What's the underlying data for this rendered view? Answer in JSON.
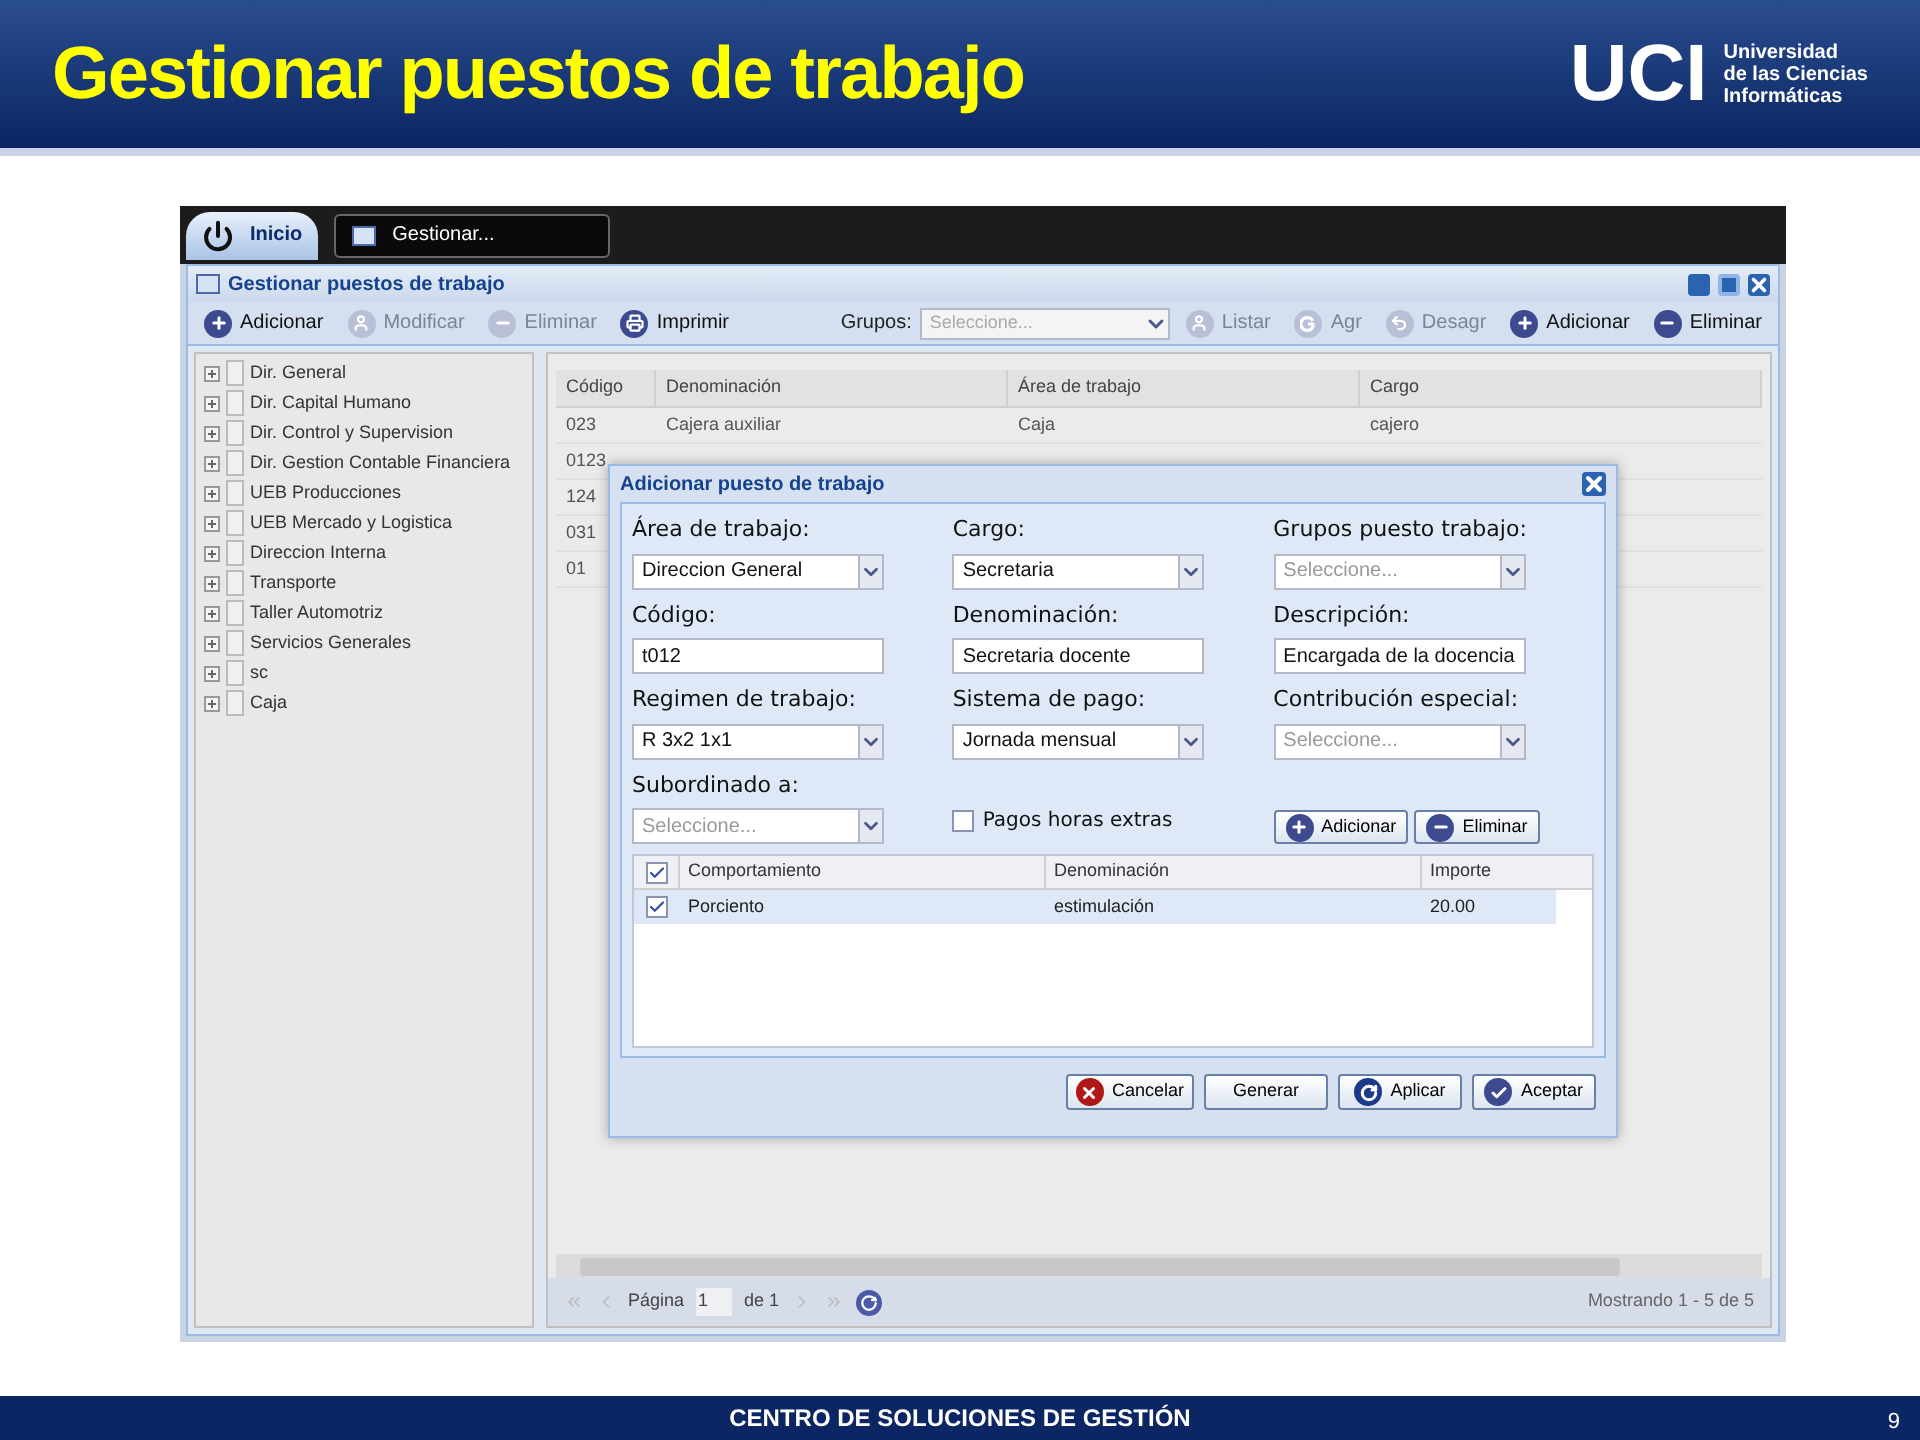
{
  "slide": {
    "title": "Gestionar puestos de trabajo",
    "logo": {
      "abbr": "UCI",
      "lines": [
        "Universidad",
        "de las Ciencias",
        "Informáticas"
      ]
    },
    "footer": "CENTRO DE SOLUCIONES DE GESTIÓN",
    "page": "9"
  },
  "taskbar": {
    "start": "Inicio",
    "tabs": [
      {
        "label": "Gestionar...",
        "selected": true
      }
    ]
  },
  "window": {
    "title": "Gestionar puestos de trabajo",
    "toolbar_left": [
      {
        "label": "Adicionar",
        "kind": "add",
        "disabled": false
      },
      {
        "label": "Modificar",
        "kind": "edit",
        "disabled": true
      },
      {
        "label": "Eliminar",
        "kind": "remove",
        "disabled": true
      },
      {
        "label": "Imprimir",
        "kind": "print",
        "disabled": false
      }
    ],
    "groups": {
      "label": "Grupos:",
      "placeholder": "Seleccione..."
    },
    "toolbar_right": [
      {
        "label": "Listar",
        "kind": "edit",
        "disabled": true
      },
      {
        "label": "Agr",
        "kind": "letter",
        "disabled": true
      },
      {
        "label": "Desagr",
        "kind": "back",
        "disabled": true
      },
      {
        "label": "Adicionar",
        "kind": "add",
        "disabled": false
      },
      {
        "label": "Eliminar",
        "kind": "remove",
        "disabled": false
      }
    ]
  },
  "tree": [
    {
      "label": "Dir. General"
    },
    {
      "label": "Dir. Capital Humano"
    },
    {
      "label": "Dir. Control y Supervision"
    },
    {
      "label": "Dir. Gestion Contable Financiera"
    },
    {
      "label": "UEB Producciones"
    },
    {
      "label": "UEB Mercado y Logistica"
    },
    {
      "label": "Direccion Interna"
    },
    {
      "label": "Transporte"
    },
    {
      "label": "Taller Automotriz"
    },
    {
      "label": "Servicios Generales"
    },
    {
      "label": "sc"
    },
    {
      "label": "Caja"
    }
  ],
  "grid": {
    "columns": [
      "Código",
      "Denominación",
      "Área de trabajo",
      "Cargo"
    ],
    "rows": [
      [
        "023",
        "Cajera auxiliar",
        "Caja",
        "cajero"
      ],
      [
        "0123"
      ],
      [
        "124"
      ],
      [
        "031"
      ],
      [
        "01"
      ]
    ]
  },
  "pager": {
    "page_label": "Página",
    "page": "1",
    "of": "de 1",
    "status": "Mostrando 1 - 5 de 5"
  },
  "dialog": {
    "title": "Adicionar puesto de trabajo",
    "fields": [
      {
        "label": "Área de trabajo:",
        "kind": "select",
        "value": "Direccion General"
      },
      {
        "label": "Cargo:",
        "kind": "select",
        "value": "Secretaria"
      },
      {
        "label": "Grupos puesto trabajo:",
        "kind": "select",
        "placeholder": "Seleccione..."
      },
      {
        "label": "Código:",
        "kind": "text",
        "value": "t012"
      },
      {
        "label": "Denominación:",
        "kind": "text",
        "value": "Secretaria docente"
      },
      {
        "label": "Descripción:",
        "kind": "text",
        "value": "Encargada de la docencia"
      },
      {
        "label": "Regimen de trabajo:",
        "kind": "select",
        "value": "R 3x2 1x1"
      },
      {
        "label": "Sistema de pago:",
        "kind": "select",
        "value": "Jornada mensual"
      },
      {
        "label": "Contribución especial:",
        "kind": "select",
        "placeholder": "Seleccione..."
      },
      {
        "label": "Subordinado a:",
        "kind": "select",
        "placeholder": "Seleccione..."
      }
    ],
    "checkbox": {
      "label": "Pagos horas extras",
      "checked": false
    },
    "buttons": [
      {
        "label": "Adicionar",
        "kind": "add"
      },
      {
        "label": "Eliminar",
        "kind": "remove"
      }
    ],
    "table": {
      "header_checked": true,
      "columns": [
        "Comportamiento",
        "Denominación",
        "Importe"
      ],
      "rows": [
        {
          "checked": true,
          "cells": [
            "Porciento",
            "estimulación",
            "20.00"
          ]
        }
      ]
    },
    "footer_buttons": [
      {
        "label": "Cancelar",
        "kind": "cancel"
      },
      {
        "label": "Generar",
        "kind": "none"
      },
      {
        "label": "Aplicar",
        "kind": "refresh"
      },
      {
        "label": "Aceptar",
        "kind": "ok"
      }
    ]
  }
}
